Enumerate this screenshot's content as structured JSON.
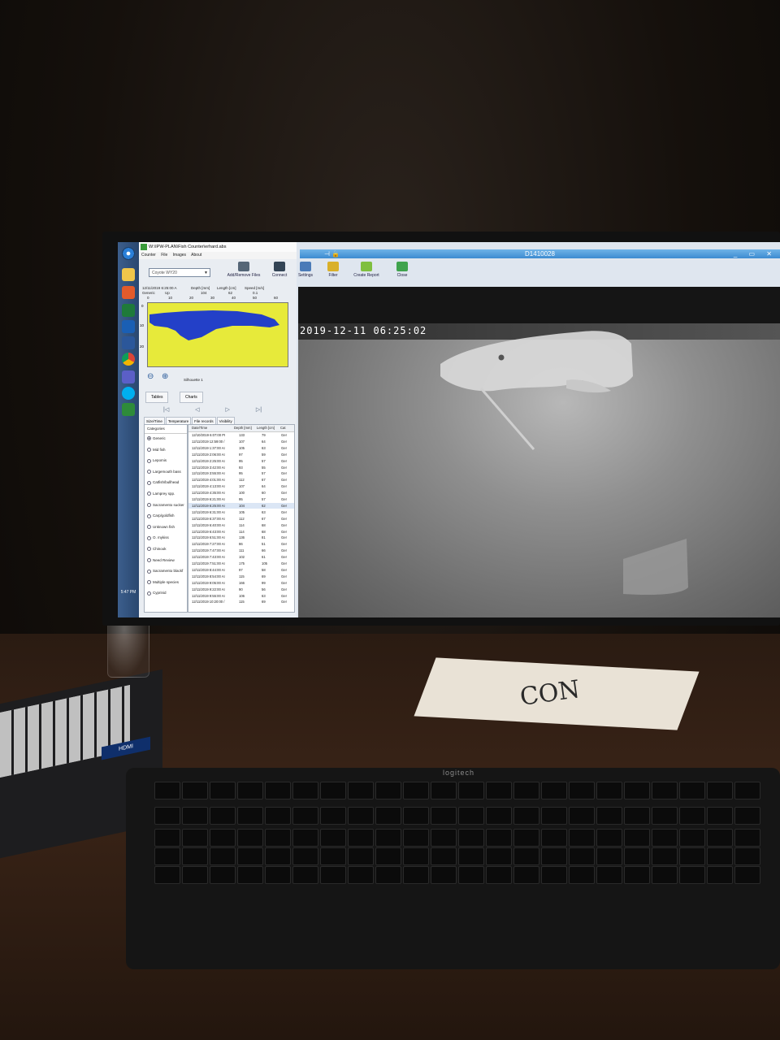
{
  "app": {
    "title": "W:\\IPW-PLAN\\Fish Counter\\erhard.abs",
    "menu": [
      "Counter",
      "File",
      "Images",
      "About"
    ],
    "site_select": "Coyote WY20"
  },
  "silhouette": {
    "datetime": "12/11/2019 6:25:00 A",
    "category": "Generic",
    "direction": "Up",
    "depth_label": "Depth [mm]",
    "depth_value": "104",
    "length_label": "Length [cm]",
    "length_value": "62",
    "speed_label": "Speed [m/s]",
    "speed_value": "0.1",
    "x_ticks": [
      "0",
      "10",
      "20",
      "30",
      "40",
      "50",
      "60"
    ],
    "y_ticks": [
      "0",
      "10",
      "20"
    ],
    "label": "Silhouette 1"
  },
  "tabs": [
    "Tables",
    "Charts"
  ],
  "nav": [
    "|◁",
    "◁",
    "▷",
    "▷|"
  ],
  "subtabs": [
    "Size/Time",
    "Temperature",
    "File records",
    "Visibility"
  ],
  "categories": {
    "header": "Categories",
    "selected": "Generic",
    "items": [
      "Generic",
      "Mid fish",
      "Lepomis",
      "Largemouth bass",
      "Catfish/bullhead",
      "Lamprey spp.",
      "Sacramento sucker",
      "Carp/goldfish",
      "Unknown fish",
      "O. mykiss",
      "Chinook",
      "Need Review",
      "Sacramento blackf",
      "Multiple species",
      "Cyprinid"
    ]
  },
  "table": {
    "columns": [
      "Date/Time",
      "Depth [mm]",
      "Length [cm]",
      "Cat"
    ],
    "rows": [
      [
        "12/10/2019 6:07:00 PI",
        "133",
        "79",
        "Ger"
      ],
      [
        "12/11/2019 12:59:00 /",
        "107",
        "64",
        "Ger"
      ],
      [
        "12/11/2019 1:37:00 AI",
        "105",
        "63",
        "Ger"
      ],
      [
        "12/11/2019 2:06:00 AI",
        "97",
        "59",
        "Ger"
      ],
      [
        "12/11/2019 2:25:00 AI",
        "95",
        "57",
        "Ger"
      ],
      [
        "12/11/2019 3:42:00 AI",
        "93",
        "55",
        "Ger"
      ],
      [
        "12/11/2019 3:55:00 AI",
        "95",
        "57",
        "Ger"
      ],
      [
        "12/11/2019 4:01:00 AI",
        "112",
        "67",
        "Ger"
      ],
      [
        "12/11/2019 4:13:00 AI",
        "107",
        "64",
        "Ger"
      ],
      [
        "12/11/2019 4:35:00 AI",
        "100",
        "60",
        "Ger"
      ],
      [
        "12/11/2019 6:21:00 AI",
        "95",
        "57",
        "Ger"
      ],
      [
        "12/11/2019 6:25:00 AI",
        "104",
        "62",
        "Ger"
      ],
      [
        "12/11/2019 6:31:00 AI",
        "105",
        "63",
        "Ger"
      ],
      [
        "12/11/2019 6:37:00 AI",
        "112",
        "67",
        "Ger"
      ],
      [
        "12/11/2019 6:40:00 AI",
        "114",
        "68",
        "Ger"
      ],
      [
        "12/11/2019 6:43:00 AI",
        "114",
        "68",
        "Ger"
      ],
      [
        "12/11/2019 6:51:00 AI",
        "136",
        "81",
        "Ger"
      ],
      [
        "12/11/2019 7:27:00 AI",
        "86",
        "51",
        "Ger"
      ],
      [
        "12/11/2019 7:47:00 AI",
        "111",
        "66",
        "Ger"
      ],
      [
        "12/11/2019 7:43:00 AI",
        "102",
        "61",
        "Ger"
      ],
      [
        "12/11/2019 7:51:00 AI",
        "175",
        "105",
        "Ger"
      ],
      [
        "12/11/2019 8:44:00 AI",
        "97",
        "58",
        "Ger"
      ],
      [
        "12/11/2019 8:54:00 AI",
        "115",
        "69",
        "Ger"
      ],
      [
        "12/11/2019 9:05:00 AI",
        "166",
        "99",
        "Ger"
      ],
      [
        "12/11/2019 9:22:00 AI",
        "90",
        "56",
        "Ger"
      ],
      [
        "12/11/2019 9:55:00 AI",
        "106",
        "63",
        "Ger"
      ],
      [
        "12/11/2019 10:20:00 /",
        "115",
        "69",
        "Ger"
      ]
    ]
  },
  "viewer": {
    "title": "D1410028",
    "timestamp": "2019-12-11  06:25:02"
  },
  "toolbar": [
    "Add/Remove Files",
    "Connect",
    "Settings",
    "Filter",
    "Create Report",
    "Close"
  ],
  "taskbar": {
    "clock": "5:47 PM"
  },
  "note": {
    "text": "CON"
  },
  "keyboard": {
    "brand": "logitech",
    "hdmi": "HDMI"
  }
}
